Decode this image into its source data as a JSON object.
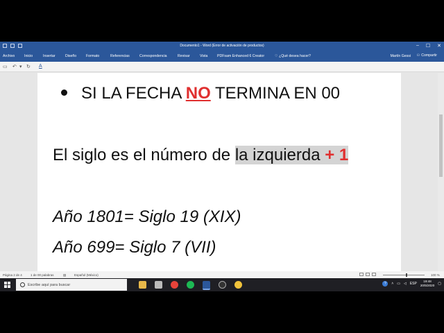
{
  "window": {
    "title": "Documento1 - Word (Error de activación de productos)",
    "controls": [
      "–",
      "☐",
      "✕"
    ]
  },
  "ribbon": {
    "tabs": [
      {
        "label": "Archivo"
      },
      {
        "label": "Inicio"
      },
      {
        "label": "Insertar"
      },
      {
        "label": "Diseño"
      },
      {
        "label": "Formato"
      },
      {
        "label": "Referencias"
      },
      {
        "label": "Correspondencia"
      },
      {
        "label": "Revisar"
      },
      {
        "label": "Vista"
      },
      {
        "label": "PDFsam Enhanced 6 Creator"
      }
    ],
    "tell_me": "¿Qué desea hacer?",
    "user": "Martín Gessi",
    "share": "Compartir"
  },
  "document": {
    "line1": {
      "pre": "SI LA FECHA ",
      "no": "NO",
      "post": " TERMINA EN 00"
    },
    "line2": {
      "pre": "El siglo es el número de ",
      "highlight": "la izquierda ",
      "plus": "+ 1"
    },
    "line3": "Año 1801= Siglo 19 (XIX)",
    "line4": "Año 699= Siglo 7 (VII)"
  },
  "status": {
    "page": "Página 2 de 4",
    "words": "1 de 00 palabras",
    "language": "Español (México)",
    "zoom": "100 %"
  },
  "taskbar": {
    "search_placeholder": "Escribe aquí para buscar",
    "language": "ESP",
    "time": "19:48",
    "date": "20/5/2020"
  },
  "colors": {
    "word_blue": "#2b579a",
    "accent_red": "#e03030",
    "highlight_gray": "#d4d4d4"
  }
}
